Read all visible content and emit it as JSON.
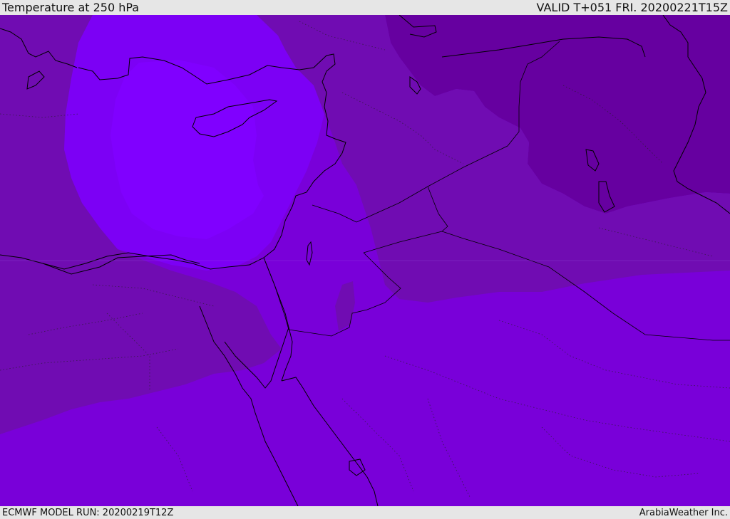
{
  "header": {
    "title": "Temperature at 250 hPa",
    "valid": "VALID T+051 FRI. 20200221T15Z"
  },
  "footer": {
    "model_run": "ECMWF MODEL RUN: 20200219T12Z",
    "credit": "ArabiaWeather Inc."
  },
  "map": {
    "field": "temperature_250hPa",
    "colors": {
      "coldest": "#6600a0",
      "colder": "#700cb2",
      "base": "#7900d9",
      "warm": "#7c00f5",
      "warmest": "#8000ff",
      "coastline": "#000000"
    }
  }
}
